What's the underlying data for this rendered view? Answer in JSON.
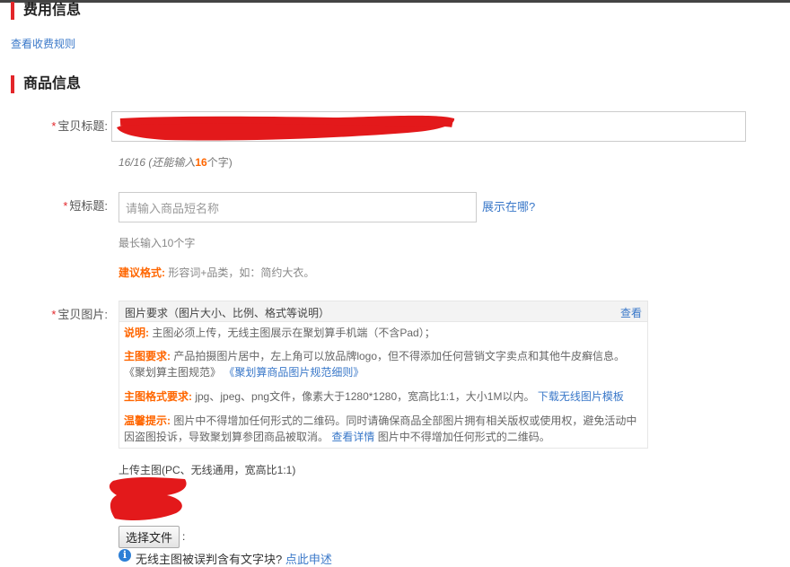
{
  "sections": {
    "fee_title": "费用信息",
    "fee_link": "查看收费规则",
    "product_title": "商品信息"
  },
  "title_field": {
    "label": "宝贝标题:",
    "counter_prefix": "16/16 (还能输入",
    "counter_num": "16",
    "counter_suffix": "个字)"
  },
  "short_title": {
    "label": "短标题:",
    "placeholder": "请输入商品短名称",
    "where_link": "展示在哪?",
    "max_hint": "最长输入10个字",
    "suggest_key": "建议格式:",
    "suggest_text": "形容词+品类，如：简约大衣。"
  },
  "images": {
    "label": "宝贝图片:",
    "req_title": "图片要求（图片大小、比例、格式等说明）",
    "req_view": "查看",
    "note_key": "说明:",
    "note_text": "主图必须上传，无线主图展示在聚划算手机端（不含Pad）；",
    "main_key": "主图要求:",
    "main_text": "产品拍摄图片居中，左上角可以放品牌logo，但不得添加任何营销文字卖点和其他牛皮癣信息。",
    "spec_text": "《聚划算主图规范》",
    "spec_link": "《聚划算商品图片规范细则》",
    "format_key": "主图格式要求:",
    "format_text": "jpg、jpeg、png文件，像素大于1280*1280，宽高比1:1，大小1M以内。",
    "format_link": "下载无线图片模板",
    "warm_key": "温馨提示:",
    "warm_text1": "图片中不得增加任何形式的二维码。同时请确保商品全部图片拥有相关版权或使用权，避免活动中",
    "warm_text2": "因盗图投诉，导致聚划算参团商品被取消。",
    "warm_link": "查看详情",
    "warm_text3": "图片中不得增加任何形式的二维码。",
    "upload_label": "上传主图(PC、无线通用，宽高比1:1)",
    "choose_file": "选择文件",
    "colon": ":",
    "misjudge_text": "无线主图被误判含有文字块?",
    "misjudge_link": "点此申述"
  },
  "colors": {
    "accent": "#e3262a",
    "link": "#3a78c9",
    "warn": "#ff6600"
  },
  "icons": {
    "info": "info-icon"
  }
}
